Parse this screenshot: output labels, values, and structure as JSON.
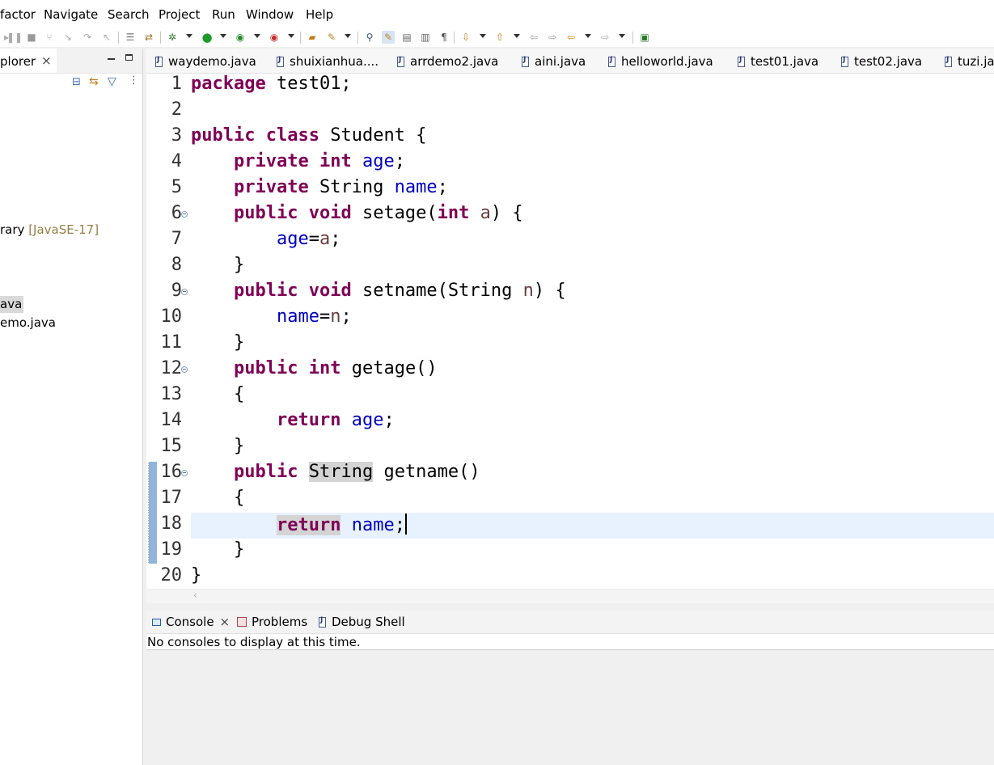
{
  "menu": [
    "factor",
    "Navigate",
    "Search",
    "Project",
    "Run",
    "Window",
    "Help"
  ],
  "left_pane": {
    "title": "plorer",
    "close_glyph": "×",
    "tree": [
      {
        "label": "rary",
        "badge": "[JavaSE-17]"
      },
      {
        "label": "ava",
        "selected": true
      },
      {
        "label": "emo.java"
      }
    ]
  },
  "editor_tabs": [
    "waydemo.java",
    "shuixianhua....",
    "arrdemo2.java",
    "aini.java",
    "helloworld.java",
    "test01.java",
    "test02.java",
    "tuzi.jav"
  ],
  "editor": {
    "line_numbers": [
      "1",
      "2",
      "3",
      "4",
      "5",
      "6",
      "7",
      "8",
      "9",
      "10",
      "11",
      "12",
      "13",
      "14",
      "15",
      "16",
      "17",
      "18",
      "19",
      "20"
    ],
    "code": {
      "l1_kw": "package",
      "l1_rest": " test01;",
      "l3_kw1": "public",
      "l3_kw2": "class",
      "l3_rest": " Student {",
      "l4_kw1": "private",
      "l4_kw2": "int",
      "l4_field": "age",
      "l4_end": ";",
      "l5_kw": "private",
      "l5_type": " String ",
      "l5_field": "name",
      "l5_end": ";",
      "l6_kw1": "public",
      "l6_kw2": "void",
      "l6_mid": " setage(",
      "l6_kw3": "int",
      "l6_param": "a",
      "l6_end": ") {",
      "l7_field": "age",
      "l7_eq": "=",
      "l7_param": "a",
      "l7_end": ";",
      "l8": "}",
      "l9_kw1": "public",
      "l9_kw2": "void",
      "l9_mid": " setname(String ",
      "l9_param": "n",
      "l9_end": ") {",
      "l10_field": "name",
      "l10_eq": "=",
      "l10_param": "n",
      "l10_end": ";",
      "l11": "}",
      "l12_kw1": "public",
      "l12_kw2": "int",
      "l12_rest": " getage()",
      "l13": "{",
      "l14_kw": "return",
      "l14_field": "age",
      "l14_end": ";",
      "l15": "}",
      "l16_kw": "public",
      "l16_type": "String",
      "l16_rest": " getname()",
      "l17": "{",
      "l18_kw": "return",
      "l18_field": "name",
      "l18_end": ";",
      "l19": "}",
      "l20": "}"
    }
  },
  "bottom_panel": {
    "tabs": [
      {
        "label": "Console",
        "active": true,
        "close_glyph": "×"
      },
      {
        "label": "Problems"
      },
      {
        "label": "Debug Shell"
      }
    ],
    "message": "No consoles to display at this time."
  }
}
